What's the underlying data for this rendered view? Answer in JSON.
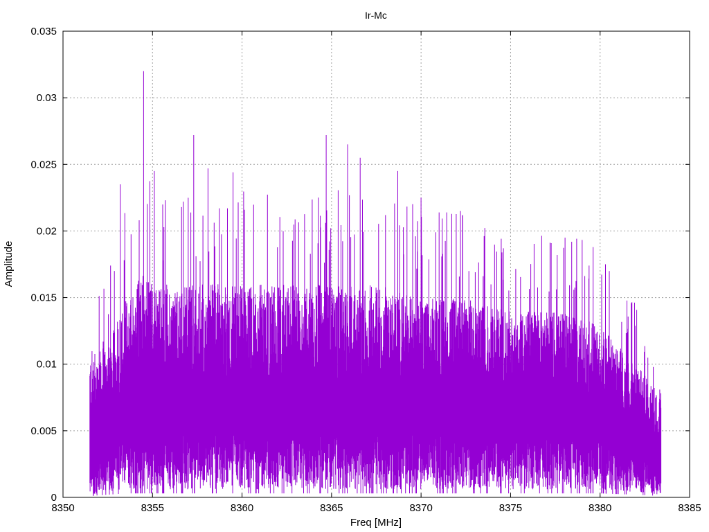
{
  "chart_data": {
    "type": "line",
    "title": "Ir-Mc",
    "xlabel": "Freq [MHz]",
    "ylabel": "Amplitude",
    "xlim": [
      8350,
      8385
    ],
    "ylim": [
      0,
      0.035
    ],
    "xticks": [
      {
        "value": 8350,
        "label": "8350"
      },
      {
        "value": 8355,
        "label": "8355"
      },
      {
        "value": 8360,
        "label": "8360"
      },
      {
        "value": 8365,
        "label": "8365"
      },
      {
        "value": 8370,
        "label": "8370"
      },
      {
        "value": 8375,
        "label": "8375"
      },
      {
        "value": 8380,
        "label": "8380"
      },
      {
        "value": 8385,
        "label": "8385"
      }
    ],
    "yticks": [
      {
        "value": 0,
        "label": "0"
      },
      {
        "value": 0.005,
        "label": "0.005"
      },
      {
        "value": 0.01,
        "label": "0.01"
      },
      {
        "value": 0.015,
        "label": "0.015"
      },
      {
        "value": 0.02,
        "label": "0.02"
      },
      {
        "value": 0.025,
        "label": "0.025"
      },
      {
        "value": 0.03,
        "label": "0.03"
      },
      {
        "value": 0.035,
        "label": "0.035"
      }
    ],
    "grid": true,
    "series": [
      {
        "color": "#9400d3",
        "x_range": [
          8351.5,
          8383.4
        ],
        "envelope": {
          "x": [
            8351.5,
            8352.5,
            8353.5,
            8354.5,
            8355.5,
            8357.5,
            8360.0,
            8362.5,
            8365.0,
            8367.5,
            8370.0,
            8372.5,
            8375.0,
            8377.5,
            8380.0,
            8382.0,
            8383.4
          ],
          "typical_max": [
            0.011,
            0.012,
            0.015,
            0.017,
            0.016,
            0.016,
            0.016,
            0.016,
            0.016,
            0.016,
            0.015,
            0.015,
            0.014,
            0.014,
            0.013,
            0.01,
            0.008
          ],
          "typical_min": [
            0.001,
            0.002,
            0.003,
            0.003,
            0.003,
            0.003,
            0.003,
            0.003,
            0.003,
            0.003,
            0.003,
            0.003,
            0.003,
            0.003,
            0.003,
            0.002,
            0.001
          ]
        },
        "peaks": [
          {
            "x": 8353.2,
            "y": 0.0235
          },
          {
            "x": 8354.5,
            "y": 0.032
          },
          {
            "x": 8355.1,
            "y": 0.0245
          },
          {
            "x": 8357.3,
            "y": 0.0272
          },
          {
            "x": 8358.1,
            "y": 0.0247
          },
          {
            "x": 8359.5,
            "y": 0.0244
          },
          {
            "x": 8364.7,
            "y": 0.0272
          },
          {
            "x": 8365.9,
            "y": 0.0265
          },
          {
            "x": 8366.6,
            "y": 0.0255
          },
          {
            "x": 8368.7,
            "y": 0.0245
          },
          {
            "x": 8370.0,
            "y": 0.0225
          },
          {
            "x": 8372.2,
            "y": 0.0215
          },
          {
            "x": 8374.6,
            "y": 0.0187
          },
          {
            "x": 8377.6,
            "y": 0.0182
          },
          {
            "x": 8380.3,
            "y": 0.0175
          }
        ]
      }
    ]
  }
}
